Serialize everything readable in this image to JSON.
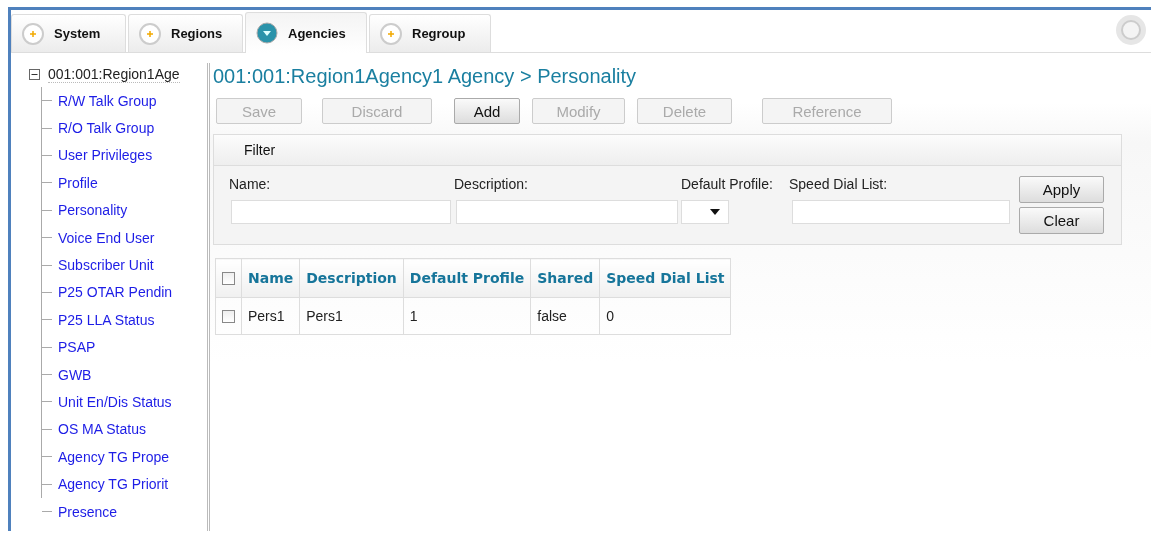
{
  "tabs": [
    {
      "label": "System",
      "selected": false
    },
    {
      "label": "Regions",
      "selected": false
    },
    {
      "label": "Agencies",
      "selected": true
    },
    {
      "label": "Regroup",
      "selected": false
    }
  ],
  "tree": {
    "label": "001:001:Region1Age",
    "expanded": true,
    "children": [
      {
        "label": "R/W Talk Group"
      },
      {
        "label": "R/O Talk Group"
      },
      {
        "label": "User Privileges"
      },
      {
        "label": "Profile"
      },
      {
        "label": "Personality"
      },
      {
        "label": "Voice End User"
      },
      {
        "label": "Subscriber Unit"
      },
      {
        "label": "P25 OTAR Pendin"
      },
      {
        "label": "P25 LLA Status"
      },
      {
        "label": "PSAP"
      },
      {
        "label": "GWB"
      },
      {
        "label": "Unit En/Dis Status"
      },
      {
        "label": "OS MA Status"
      },
      {
        "label": "Agency TG Prope"
      },
      {
        "label": "Agency TG Priorit"
      },
      {
        "label": "Presence"
      }
    ]
  },
  "page_title": "001:001:Region1Agency1 Agency > Personality",
  "toolbar": [
    {
      "label": "Save",
      "disabled": true
    },
    {
      "label": "Discard",
      "disabled": true
    },
    {
      "label": "Add",
      "disabled": false
    },
    {
      "label": "Modify",
      "disabled": true
    },
    {
      "label": "Delete",
      "disabled": true
    },
    {
      "label": "Reference",
      "disabled": true
    }
  ],
  "filter": {
    "title": "Filter",
    "fields": [
      {
        "label": "Name:",
        "kind": "text"
      },
      {
        "label": "Description:",
        "kind": "text"
      },
      {
        "label": "Default Profile:",
        "kind": "select"
      },
      {
        "label": "Speed Dial List:",
        "kind": "text"
      }
    ],
    "buttons": [
      "Apply",
      "Clear"
    ]
  },
  "table": {
    "select_all_checked": false,
    "columns": [
      "Name",
      "Description",
      "Default Profile",
      "Shared",
      "Speed Dial List"
    ],
    "rows": [
      {
        "checked": false,
        "cells": [
          "Pers1",
          "Pers1",
          "1",
          "false",
          "0"
        ]
      }
    ]
  }
}
